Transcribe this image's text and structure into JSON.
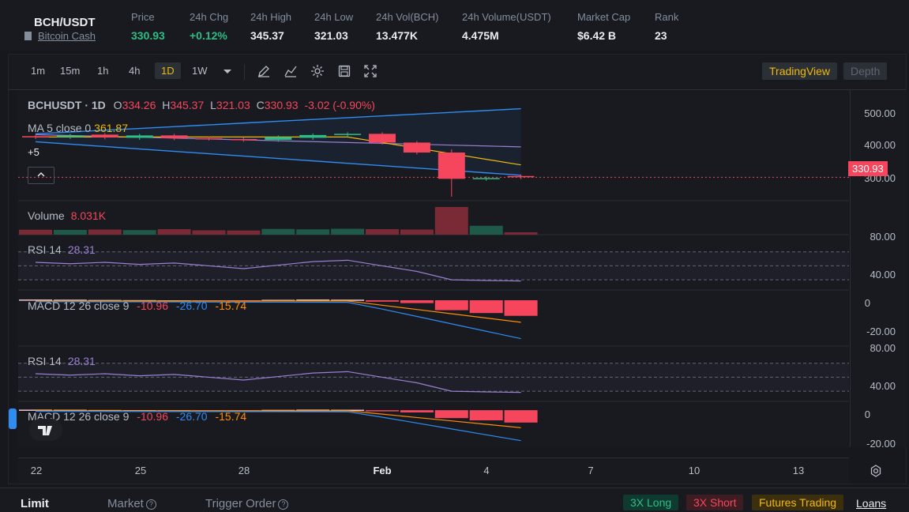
{
  "header": {
    "pair": "BCH/USDT",
    "coin_name": "Bitcoin Cash",
    "stats": [
      {
        "label": "Price",
        "value": "330.93",
        "color": "#2ebd85"
      },
      {
        "label": "24h Chg",
        "value": "+0.12%",
        "color": "#2ebd85"
      },
      {
        "label": "24h High",
        "value": "345.37"
      },
      {
        "label": "24h Low",
        "value": "321.03"
      },
      {
        "label": "24h Vol(BCH)",
        "value": "13.477K"
      },
      {
        "label": "24h Volume(USDT)",
        "value": "4.475M"
      },
      {
        "label": "Market Cap",
        "value": "$6.42 B"
      },
      {
        "label": "Rank",
        "value": "23"
      }
    ]
  },
  "toolbar": {
    "timeframes": [
      "1m",
      "15m",
      "1h",
      "4h",
      "1D",
      "1W"
    ],
    "active_timeframe": "1D",
    "tools": [
      "dropdown-icon",
      "pencil-icon",
      "indicator-icon",
      "gear-icon",
      "save-icon",
      "fullscreen-icon"
    ],
    "tradingview_label": "TradingView",
    "depth_label": "Depth"
  },
  "chart": {
    "symbol_title": "BCHUSDT · 1D",
    "ohlc": {
      "o_label": "O",
      "o": "334.26",
      "h_label": "H",
      "h": "345.37",
      "l_label": "L",
      "l": "321.03",
      "c_label": "C",
      "c": "330.93",
      "chg": "-3.02 (-0.90%)"
    },
    "ma_label": "MA 5 close 0",
    "ma_value": "361.87",
    "more_indicators": "+5",
    "volume_label": "Volume",
    "volume_value": "8.031K",
    "rsi_label": "RSI 14",
    "rsi_value": "28.31",
    "macd_label": "MACD 12 26 close 9",
    "macd_v1": "-10.96",
    "macd_v2": "-26.70",
    "macd_v3": "-15.74",
    "price_axis": [
      "500.00",
      "400.00",
      "300.00"
    ],
    "current_price_tag": "330.93",
    "rsi_axis": [
      "80.00",
      "40.00"
    ],
    "macd_axis": [
      "0",
      "-20.00"
    ],
    "x_axis": [
      "22",
      "25",
      "28",
      "Feb",
      "4",
      "7",
      "10",
      "13"
    ]
  },
  "chart_data": {
    "type": "candlestick",
    "x": [
      "Jan 21",
      "Jan 22",
      "Jan 23",
      "Jan 24",
      "Jan 25",
      "Jan 26",
      "Jan 27",
      "Jan 28",
      "Jan 29",
      "Jan 30",
      "Jan 31",
      "Feb 1",
      "Feb 2",
      "Feb 3",
      "Feb 4"
    ],
    "open": [
      434,
      432,
      438,
      430,
      436,
      429,
      427,
      425,
      430,
      437,
      440,
      418,
      393,
      327,
      334
    ],
    "close": [
      432,
      436,
      431,
      436,
      429,
      428,
      425,
      432,
      437,
      440,
      418,
      393,
      327,
      329,
      331
    ],
    "volume": [
      2.5,
      2.4,
      2.6,
      2.3,
      2.8,
      2.2,
      2.1,
      2.9,
      2.7,
      3.0,
      2.8,
      2.6,
      14.0,
      4.5,
      1.2
    ],
    "rsi": [
      55,
      53,
      55,
      52,
      54,
      50,
      46,
      51,
      56,
      58,
      50,
      42,
      30,
      29,
      28.31
    ],
    "macd_hist": [
      0.5,
      0.4,
      0.2,
      0.1,
      0.0,
      -0.5,
      -1.0,
      0.3,
      0.5,
      0.4,
      -1.0,
      -2.0,
      -7.0,
      -9.0,
      -10.96
    ],
    "ylim_price": [
      280,
      530
    ],
    "rsi_ylim": [
      20,
      90
    ],
    "macd_ylim": [
      -30,
      5
    ],
    "colors": {
      "up": "#2ebd85",
      "down": "#f6465d",
      "ma": "#f0b90b",
      "boll_upper": "#2f8cf2",
      "boll_mid": "#9b7fd0",
      "rsi": "#9b7fd0",
      "macd": "#2f8cf2",
      "signal": "#ff8c00"
    }
  },
  "bottom": {
    "tabs": [
      "Limit",
      "Market",
      "Trigger Order"
    ],
    "long_label": "3X Long",
    "short_label": "3X Short",
    "futures_label": "Futures Trading",
    "loans_label": "Loans"
  }
}
